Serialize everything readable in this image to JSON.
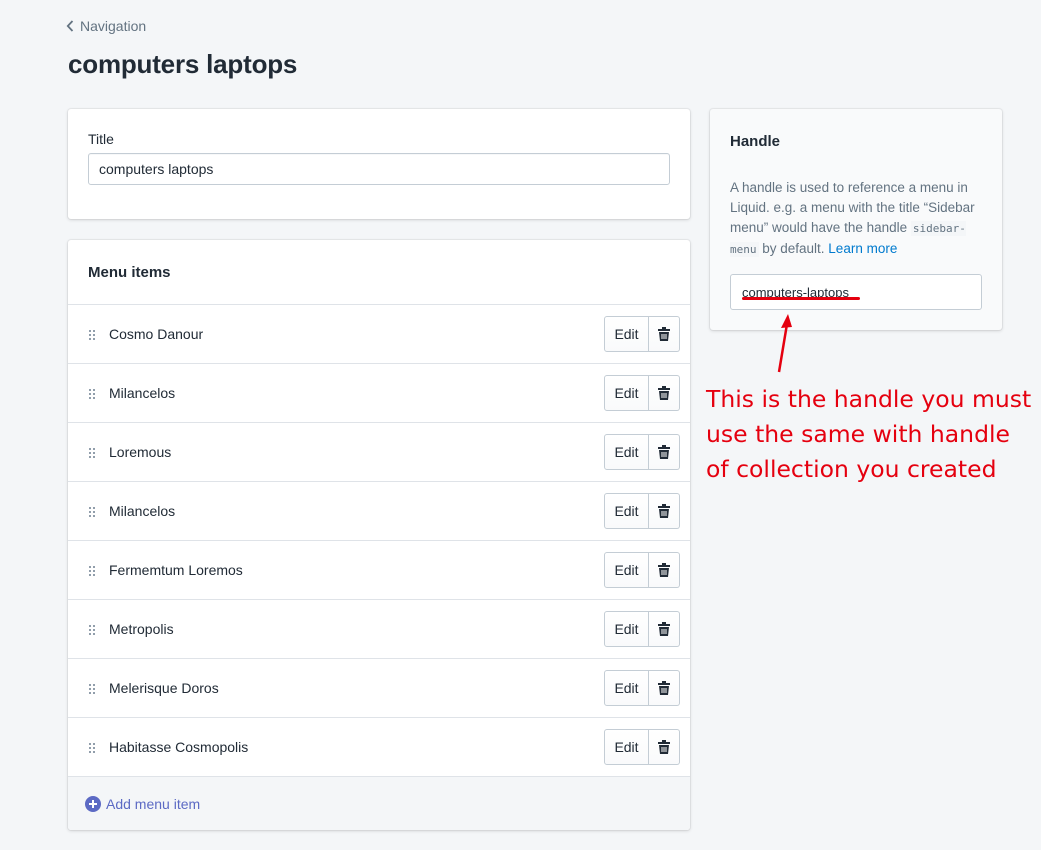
{
  "breadcrumb": {
    "label": "Navigation"
  },
  "page": {
    "title": "computers laptops"
  },
  "title_card": {
    "label": "Title",
    "value": "computers laptops"
  },
  "menu": {
    "heading": "Menu items",
    "edit_label": "Edit",
    "items": [
      {
        "label": "Cosmo Danour"
      },
      {
        "label": "Milancelos"
      },
      {
        "label": "Loremous"
      },
      {
        "label": "Milancelos"
      },
      {
        "label": "Fermemtum Loremos"
      },
      {
        "label": "Metropolis"
      },
      {
        "label": "Melerisque Doros"
      },
      {
        "label": "Habitasse Cosmopolis"
      }
    ],
    "add_label": "Add menu item"
  },
  "handle": {
    "heading": "Handle",
    "desc_part1": "A handle is used to reference a menu in Liquid. e.g. a menu with the title “Sidebar menu” would have the handle ",
    "code": "sidebar-menu",
    "desc_part2": " by default. ",
    "learn_more": "Learn more",
    "value": "computers-laptops"
  },
  "annotation": {
    "text": "This is the handle you must use the same with handle of collection you created"
  },
  "colors": {
    "accent": "#5c6ac4",
    "link": "#007ace",
    "annotation": "#e5000f"
  }
}
